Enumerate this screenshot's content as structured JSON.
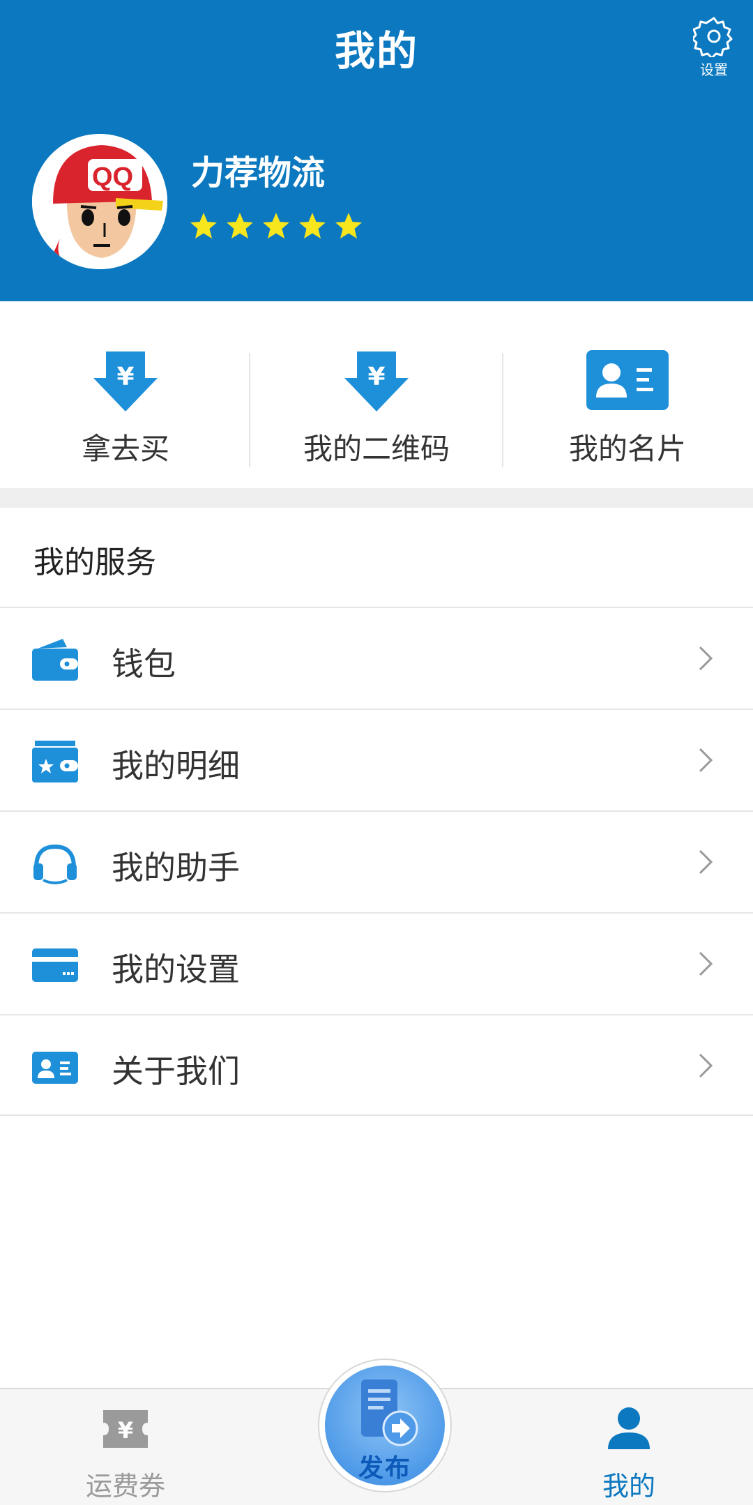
{
  "header": {
    "title": "我的",
    "settings_label": "设置",
    "bg_color": "#0b78bf"
  },
  "profile": {
    "name": "力荐物流",
    "rating_stars": 5,
    "avatar_icon": "qq-cartoon-avatar"
  },
  "quick_actions": [
    {
      "label": "拿去买",
      "icon": "yen-download-icon"
    },
    {
      "label": "我的二维码",
      "icon": "yen-download-icon"
    },
    {
      "label": "我的名片",
      "icon": "contact-card-icon"
    }
  ],
  "services": {
    "title": "我的服务",
    "items": [
      {
        "label": "钱包",
        "icon": "wallet-icon"
      },
      {
        "label": "我的明细",
        "icon": "detail-card-icon"
      },
      {
        "label": "我的助手",
        "icon": "headset-icon"
      },
      {
        "label": "我的设置",
        "icon": "credit-card-icon"
      },
      {
        "label": "关于我们",
        "icon": "contact-card-icon"
      }
    ]
  },
  "tabbar": {
    "coupon_label": "运费券",
    "publish_label": "发布",
    "mine_label": "我的",
    "active_color": "#0b78bf",
    "inactive_color": "#9a9a9a"
  }
}
